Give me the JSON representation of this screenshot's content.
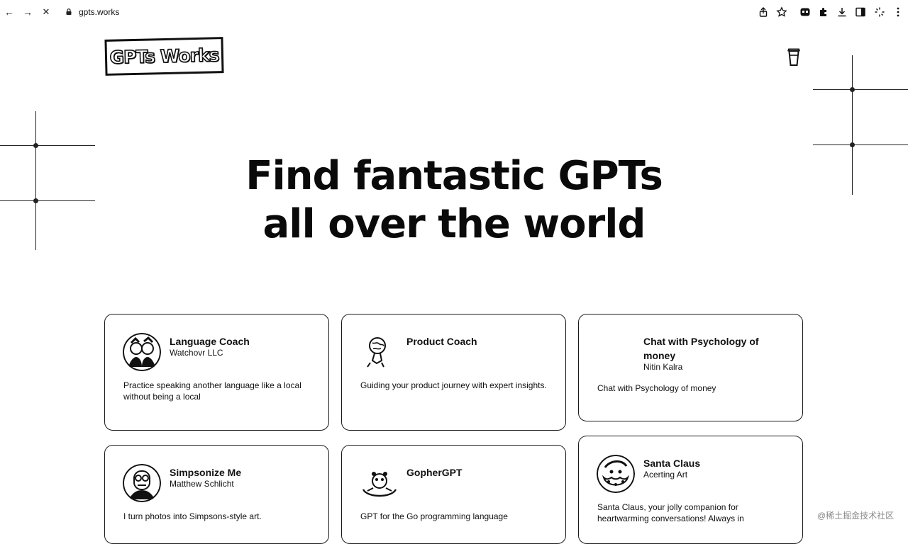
{
  "browser": {
    "url": "gpts.works",
    "back_icon": "←",
    "forward_icon": "→",
    "stop_icon": "✕"
  },
  "header": {
    "logo_text": "GPTs Works"
  },
  "hero": {
    "line1": "Find fantastic GPTs",
    "line2": "all over the world"
  },
  "cards": [
    {
      "title": "Language Coach",
      "author": "Watchovr LLC",
      "description": "Practice speaking another language like a local without being a local"
    },
    {
      "title": "Product Coach",
      "author": "",
      "description": "Guiding your product journey with expert insights."
    },
    {
      "title": "Chat with Psychology of money",
      "author": "Nitin Kalra",
      "description": "Chat with Psychology of money"
    },
    {
      "title": "Simpsonize Me",
      "author": "Matthew Schlicht",
      "description": "I turn photos into Simpsons-style art."
    },
    {
      "title": "GopherGPT",
      "author": "",
      "description": "GPT for the Go programming language"
    },
    {
      "title": "Santa Claus",
      "author": "Acerting Art",
      "description": "Santa Claus, your jolly companion for heartwarming conversations! Always in"
    }
  ],
  "watermark": "@稀土掘金技术社区"
}
